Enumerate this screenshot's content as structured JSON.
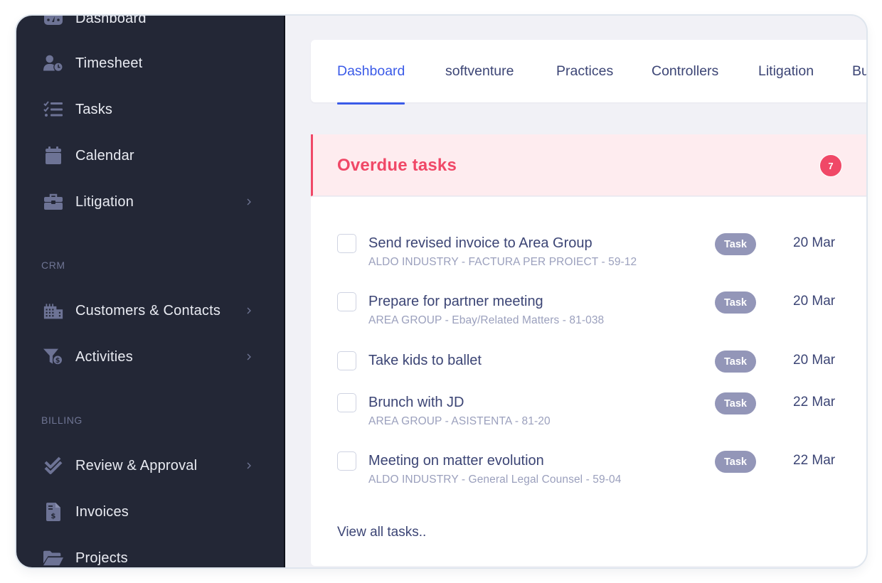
{
  "sidebar": {
    "items": [
      {
        "label": "Dashboard",
        "icon": "dashboard-icon",
        "has_submenu": false
      },
      {
        "label": "Timesheet",
        "icon": "user-clock-icon",
        "has_submenu": false
      },
      {
        "label": "Tasks",
        "icon": "task-list-icon",
        "has_submenu": false
      },
      {
        "label": "Calendar",
        "icon": "calendar-icon",
        "has_submenu": false
      },
      {
        "label": "Litigation",
        "icon": "briefcase-icon",
        "has_submenu": true
      }
    ],
    "crm": {
      "section_label": "CRM",
      "items": [
        {
          "label": "Customers & Contacts",
          "icon": "building-icon",
          "has_submenu": true
        },
        {
          "label": "Activities",
          "icon": "funnel-dollar-icon",
          "has_submenu": true
        }
      ]
    },
    "billing": {
      "section_label": "BILLING",
      "items": [
        {
          "label": "Review & Approval",
          "icon": "double-check-icon",
          "has_submenu": true
        },
        {
          "label": "Invoices",
          "icon": "invoice-icon",
          "has_submenu": false
        },
        {
          "label": "Projects",
          "icon": "folder-open-icon",
          "has_submenu": false
        }
      ]
    }
  },
  "tabs": [
    {
      "label": "Dashboard",
      "active": true
    },
    {
      "label": "softventure",
      "active": false
    },
    {
      "label": "Practices",
      "active": false
    },
    {
      "label": "Controllers",
      "active": false
    },
    {
      "label": "Litigation",
      "active": false
    },
    {
      "label": "Bu",
      "active": false
    }
  ],
  "overdue": {
    "title": "Overdue tasks",
    "count": "7",
    "tasks": [
      {
        "title": "Send revised invoice to Area Group",
        "subtitle": "ALDO INDUSTRY - FACTURA PER PROIECT - 59-12",
        "type": "Task",
        "date": "20 Mar",
        "checked": false
      },
      {
        "title": "Prepare for partner meeting",
        "subtitle": "AREA GROUP - Ebay/Related Matters - 81-038",
        "type": "Task",
        "date": "20 Mar",
        "checked": false
      },
      {
        "title": "Take kids to ballet",
        "subtitle": "",
        "type": "Task",
        "date": "20 Mar",
        "checked": false
      },
      {
        "title": "Brunch with JD",
        "subtitle": "AREA GROUP - ASISTENTA - 81-20",
        "type": "Task",
        "date": "22 Mar",
        "checked": false
      },
      {
        "title": "Meeting on matter evolution",
        "subtitle": "ALDO INDUSTRY - General Legal Counsel - 59-04",
        "type": "Task",
        "date": "22 Mar",
        "checked": false
      }
    ],
    "view_all_label": "View all tasks.."
  },
  "colors": {
    "sidebar_bg": "#232736",
    "accent": "#3b5be8",
    "danger": "#f04867",
    "badge_bg": "#9396b8",
    "text_primary": "#3c4575",
    "text_muted": "#9ba0bd"
  }
}
